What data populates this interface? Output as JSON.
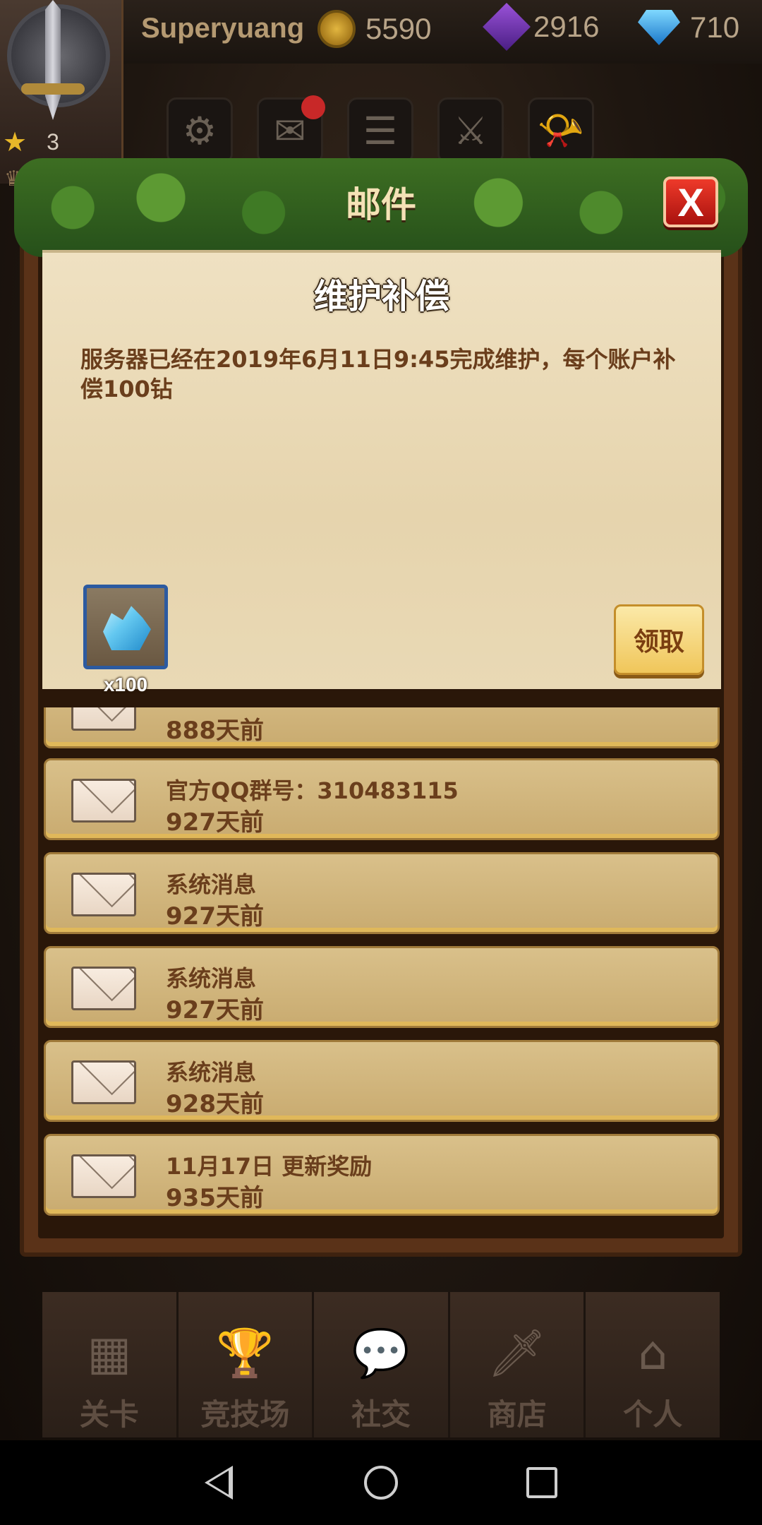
{
  "player": {
    "name": "Superyuang",
    "stars": "3",
    "gold": "5590",
    "purple_gems": "2916",
    "diamonds": "710"
  },
  "toolbar": [
    {
      "icon": "gear-icon",
      "glyph": "⚙"
    },
    {
      "icon": "mail-icon",
      "glyph": "✉",
      "has_badge": true
    },
    {
      "icon": "list-icon",
      "glyph": "☰"
    },
    {
      "icon": "crossed-swords-icon",
      "glyph": "⚔"
    },
    {
      "icon": "horn-icon",
      "glyph": "📯"
    }
  ],
  "modal": {
    "title": "邮件",
    "close_label": "X"
  },
  "detail": {
    "title": "维护补偿",
    "body": "服务器已经在2019年6月11日9:45完成维护，每个账户补偿100钻",
    "reward_icon": "diamond-pile-icon",
    "reward_qty": "x100",
    "claim_label": "领取"
  },
  "mails": [
    {
      "subject": "",
      "age": "888天前"
    },
    {
      "subject": "官方QQ群号：310483115",
      "age": "927天前"
    },
    {
      "subject": "系统消息",
      "age": "927天前"
    },
    {
      "subject": "系统消息",
      "age": "927天前"
    },
    {
      "subject": "系统消息",
      "age": "928天前"
    },
    {
      "subject": "11月17日 更新奖励",
      "age": "935天前"
    }
  ],
  "bottom_nav": [
    {
      "label": "关卡",
      "icon": "grid-icon",
      "glyph": "▦"
    },
    {
      "label": "竞技场",
      "icon": "podium-icon",
      "glyph": "🏆"
    },
    {
      "label": "社交",
      "icon": "chat-bubble-icon",
      "glyph": "💬"
    },
    {
      "label": "商店",
      "icon": "dagger-icon",
      "glyph": "🗡"
    },
    {
      "label": "个人",
      "icon": "house-icon",
      "glyph": "⌂"
    }
  ]
}
